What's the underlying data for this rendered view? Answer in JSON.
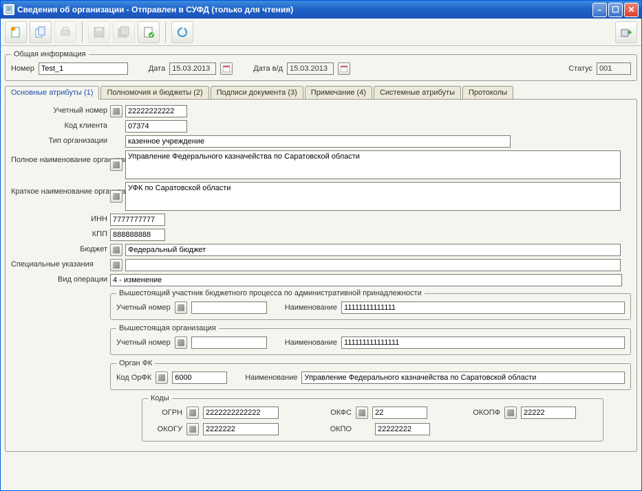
{
  "window": {
    "title": "Сведения об организации - Отправлен в СУФД (только для чтения)"
  },
  "general": {
    "legend": "Общая информация",
    "number_label": "Номер",
    "number_value": "Test_1",
    "date_label": "Дата",
    "date_value": "15.03.2013",
    "date_vd_label": "Дата в/д",
    "date_vd_value": "15.03.2013",
    "status_label": "Статус",
    "status_value": "001"
  },
  "tabs": {
    "t1": "Основные атрибуты (1)",
    "t2": "Полномочия и бюджеты (2)",
    "t3": "Подписи документа (3)",
    "t4": "Примечание (4)",
    "t5": "Системные атрибуты",
    "t6": "Протоколы"
  },
  "main": {
    "acct_label": "Учетный номер",
    "acct_value": "22222222222",
    "client_label": "Код клиента",
    "client_value": "07374",
    "orgtype_label": "Тип организации",
    "orgtype_value": "казенное учреждение",
    "fullname_label": "Полное наименование организации",
    "fullname_value": "Управление Федерального казначейства по Саратовской области",
    "shortname_label": "Краткое наименование организации",
    "shortname_value": "УФК по Саратовской области",
    "inn_label": "ИНН",
    "inn_value": "7777777777",
    "kpp_label": "КПП",
    "kpp_value": "888888888",
    "budget_label": "Бюджет",
    "budget_value": "Федеральный бюджет",
    "special_label": "Специальные указания",
    "special_value": "",
    "optype_label": "Вид операции",
    "optype_value": "4 - изменение"
  },
  "parent": {
    "legend": "Вышестоящий участник бюджетного процесса по административной принадлежности",
    "acct_label": "Учетный номер",
    "acct_value": "",
    "name_label": "Наименование",
    "name_value": "11111111111111"
  },
  "parent_org": {
    "legend": "Вышестоящая организация",
    "acct_label": "Учетный номер",
    "acct_value": "",
    "name_label": "Наименование",
    "name_value": "111111111111111"
  },
  "organ_fk": {
    "legend": "Орган ФК",
    "code_label": "Код ОрФК",
    "code_value": "6000",
    "name_label": "Наименование",
    "name_value": "Управление Федерального казначейства по Саратовской области"
  },
  "codes": {
    "legend": "Коды",
    "ogrn_label": "ОГРН",
    "ogrn_value": "2222222222222",
    "okfs_label": "ОКФС",
    "okfs_value": "22",
    "okopf_label": "ОКОПФ",
    "okopf_value": "22222",
    "okogu_label": "ОКОГУ",
    "okogu_value": "2222222",
    "okpo_label": "ОКПО",
    "okpo_value": "22222222"
  }
}
